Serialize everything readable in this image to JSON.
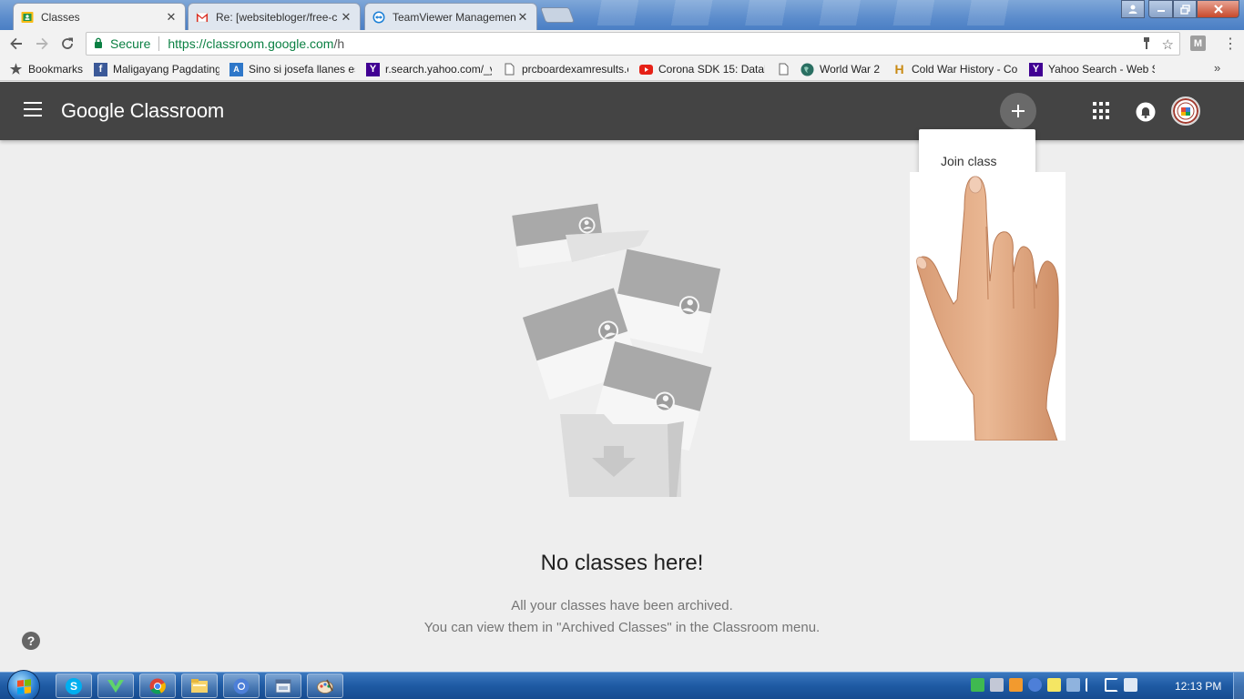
{
  "browser": {
    "tabs": [
      {
        "title": "Classes",
        "icon": "classroom-icon",
        "active": true
      },
      {
        "title": "Re: [websitebloger/free-c",
        "icon": "gmail-icon",
        "active": false
      },
      {
        "title": "TeamViewer Managemen",
        "icon": "teamviewer-icon",
        "active": false
      }
    ],
    "address": {
      "secure_label": "Secure",
      "url_scheme_host": "https://classroom.google.com",
      "url_path": "/h"
    },
    "profile_badge": "M",
    "bookmarks": [
      {
        "label": "Bookmarks",
        "icon": "star-icon"
      },
      {
        "label": "Maligayang Pagdating",
        "icon": "facebook-icon"
      },
      {
        "label": "Sino si josefa llanes es",
        "icon": "answers-icon"
      },
      {
        "label": "r.search.yahoo.com/_y",
        "icon": "yahoo-icon"
      },
      {
        "label": "prcboardexamresults.c",
        "icon": "page-icon"
      },
      {
        "label": "Corona SDK 15: Datab",
        "icon": "youtube-icon"
      },
      {
        "label": "",
        "icon": "page-icon"
      },
      {
        "label": "World War 2",
        "icon": "globe-icon"
      },
      {
        "label": "Cold War History - Co",
        "icon": "history-icon"
      },
      {
        "label": "Yahoo Search - Web S",
        "icon": "yahoo-icon"
      }
    ],
    "bookmarks_overflow": "»"
  },
  "appbar": {
    "title": "Google Classroom"
  },
  "menu": {
    "items": [
      "Join class"
    ]
  },
  "empty_state": {
    "title": "No classes here!",
    "line1": "All your classes have been archived.",
    "line2": "You can view them in \"Archived Classes\" in the Classroom menu."
  },
  "help_label": "?",
  "taskbar": {
    "clock": "12:13 PM",
    "pinned": [
      "skype-icon",
      "vectorworks-icon",
      "chrome-icon",
      "file-explorer-icon",
      "chrome-app-icon",
      "window-icon",
      "paint-icon"
    ]
  },
  "colors": {
    "appbar_bg": "#444444",
    "page_bg": "#eeeeee",
    "secure_green": "#0b8043"
  }
}
